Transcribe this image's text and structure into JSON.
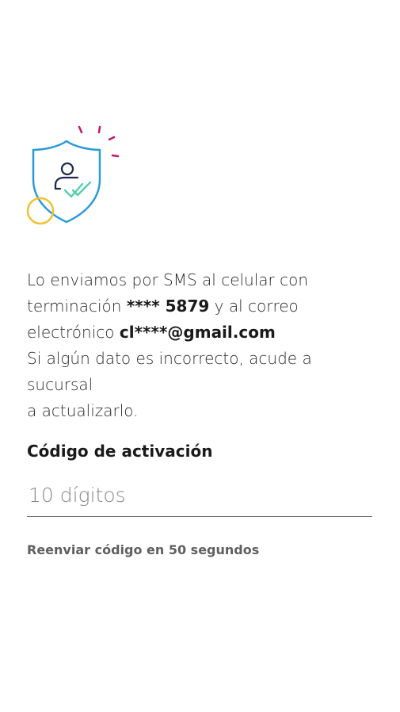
{
  "message": {
    "line1": "Lo enviamos por SMS al celular con",
    "line2_prefix": "terminación ",
    "phone_masked": "**** 5879",
    "line2_suffix": " y al correo",
    "line3_prefix": "electrónico ",
    "email_masked": "cl****@gmail.com",
    "line4": "Si algún dato es incorrecto, acude a sucursal",
    "line5": "a actualizarlo."
  },
  "activation": {
    "label": "Código de activación",
    "placeholder": "10 dígitos",
    "value": ""
  },
  "resend": {
    "label": "Reenviar código en 50 segundos"
  },
  "colors": {
    "shield_blue": "#2b9bd7",
    "accent_magenta": "#c2186b",
    "check_green": "#4fd1a5",
    "circle_yellow": "#f1c232",
    "person_navy": "#1d2b4f"
  },
  "icons": {
    "illustration": "shield-user-check-icon"
  }
}
